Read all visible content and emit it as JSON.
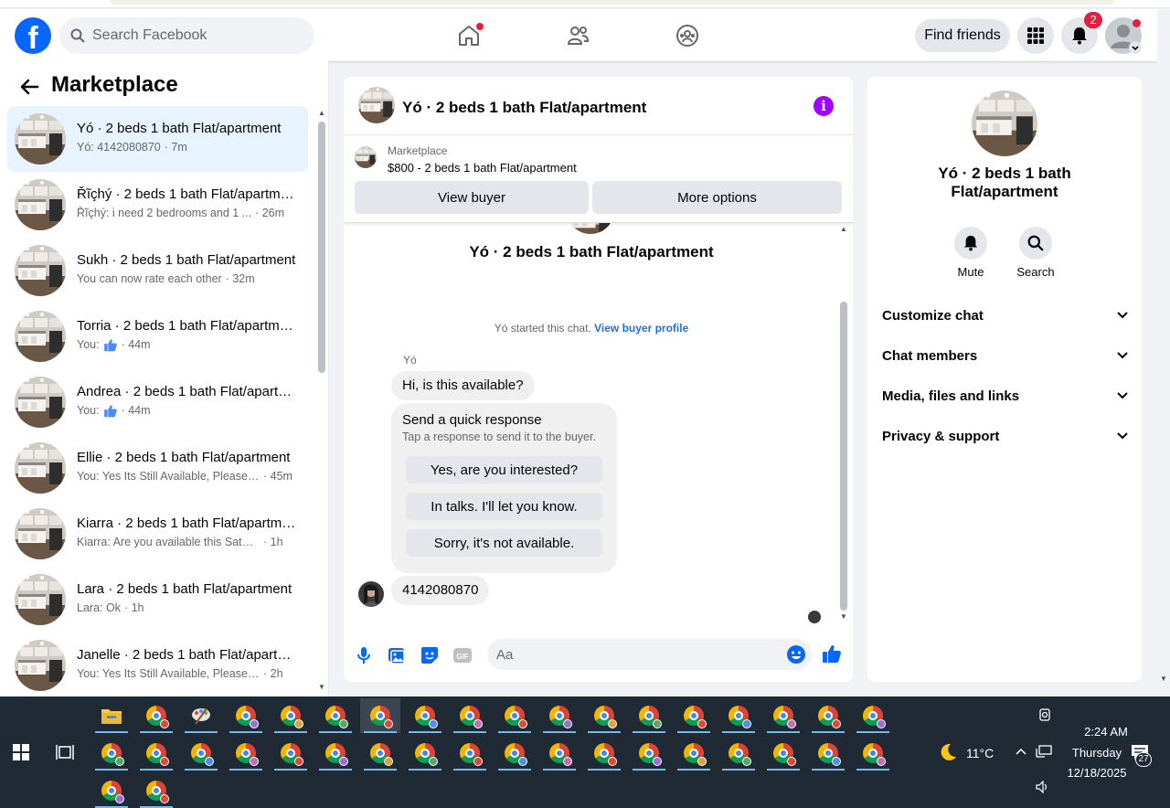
{
  "header": {
    "logo": "f",
    "search_placeholder": "Search Facebook",
    "find_friends": "Find friends",
    "notifications_count": "2"
  },
  "left": {
    "title": "Marketplace",
    "conversations": [
      {
        "name": "Yó · 2 beds 1 bath Flat/apartment",
        "preview": "Yó: 4142080870",
        "time": "· 7m",
        "active": true
      },
      {
        "name": "Řĩçhý · 2 beds 1 bath Flat/apartment",
        "preview": "Řĩçhý: i need 2 bedrooms and 1 ...",
        "time": "· 26m"
      },
      {
        "name": "Sukh · 2 beds 1 bath Flat/apartment",
        "preview": "You can now rate each other",
        "time": "· 32m"
      },
      {
        "name": "Torria · 2 beds 1 bath Flat/apartment",
        "preview": "You:",
        "like": true,
        "time": "· 44m"
      },
      {
        "name": "Andrea · 2 beds 1 bath Flat/apartment",
        "preview": "You:",
        "like": true,
        "time": "· 44m"
      },
      {
        "name": "Ellie · 2 beds 1 bath Flat/apartment",
        "preview": "You: Yes Its Still Available, Please ...",
        "time": "· 45m"
      },
      {
        "name": "Kiarra · 2 beds 1 bath Flat/apartment",
        "preview": "Kiarra: Are you available this Saturd...",
        "time": "· 1h"
      },
      {
        "name": "Lara · 2 beds 1 bath Flat/apartment",
        "preview": "Lara: Ok",
        "time": "· 1h"
      },
      {
        "name": "Janelle · 2 beds 1 bath Flat/apartment",
        "preview": "You: Yes Its Still Available, Please Se...",
        "time": "· 2h"
      }
    ]
  },
  "chat": {
    "title": "Yó · 2 beds 1 bath Flat/apartment",
    "listing_label": "Marketplace",
    "listing_desc": "$800 - 2 beds 1 bath Flat/apartment",
    "view_buyer": "View buyer",
    "more_options": "More options",
    "center_name": "Yó · 2 beds 1 bath Flat/apartment",
    "started_text": "Yó started this chat.",
    "view_buyer_profile": "View buyer profile",
    "sender": "Yó",
    "msg1": "Hi, is this available?",
    "quick_title": "Send a quick response",
    "quick_sub": "Tap a response to send it to the buyer.",
    "quick_responses": [
      "Yes, are you interested?",
      "In talks. I'll let you know.",
      "Sorry, it's not available."
    ],
    "msg2": "4142080870",
    "input_placeholder": "Aa"
  },
  "right": {
    "title": "Yó · 2 beds 1 bath Flat/apartment",
    "mute": "Mute",
    "search": "Search",
    "sections": [
      "Customize chat",
      "Chat members",
      "Media, files and links",
      "Privacy & support"
    ]
  },
  "taskbar": {
    "weather": "11°C",
    "time": "2:24 AM",
    "day": "Thursday",
    "date": "12/18/2025",
    "notif_count": "27"
  },
  "colors": {
    "brand": "#0866ff",
    "accent_purple": "#a100ff",
    "active_conv": "#e7f3ff"
  }
}
